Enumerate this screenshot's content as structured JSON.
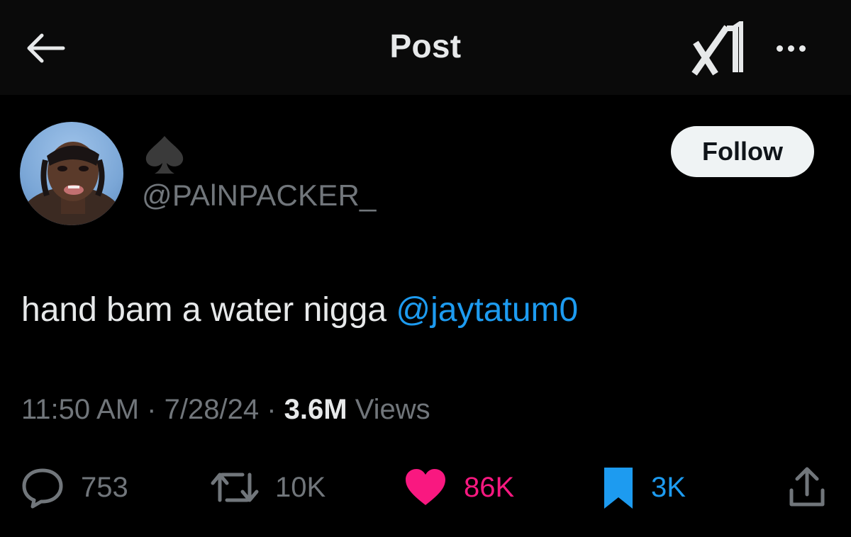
{
  "header": {
    "title": "Post"
  },
  "author": {
    "handle": "@PAlNPACKER_",
    "follow_label": "Follow"
  },
  "post": {
    "text": "hand bam a water nigga ",
    "mention": "@jaytatum0",
    "time": "11:50 AM",
    "date": "7/28/24",
    "views_count": "3.6M",
    "views_label": "Views"
  },
  "actions": {
    "replies": "753",
    "reposts": "10K",
    "likes": "86K",
    "bookmarks": "3K"
  },
  "colors": {
    "background": "#000000",
    "text": "#e7e9ea",
    "muted": "#71767b",
    "link": "#1d9bf0",
    "like": "#f91880"
  },
  "icons": [
    "back-arrow-icon",
    "x-logo-icon",
    "more-icon",
    "spade-icon",
    "reply-icon",
    "repost-icon",
    "like-icon",
    "bookmark-icon",
    "share-icon"
  ]
}
